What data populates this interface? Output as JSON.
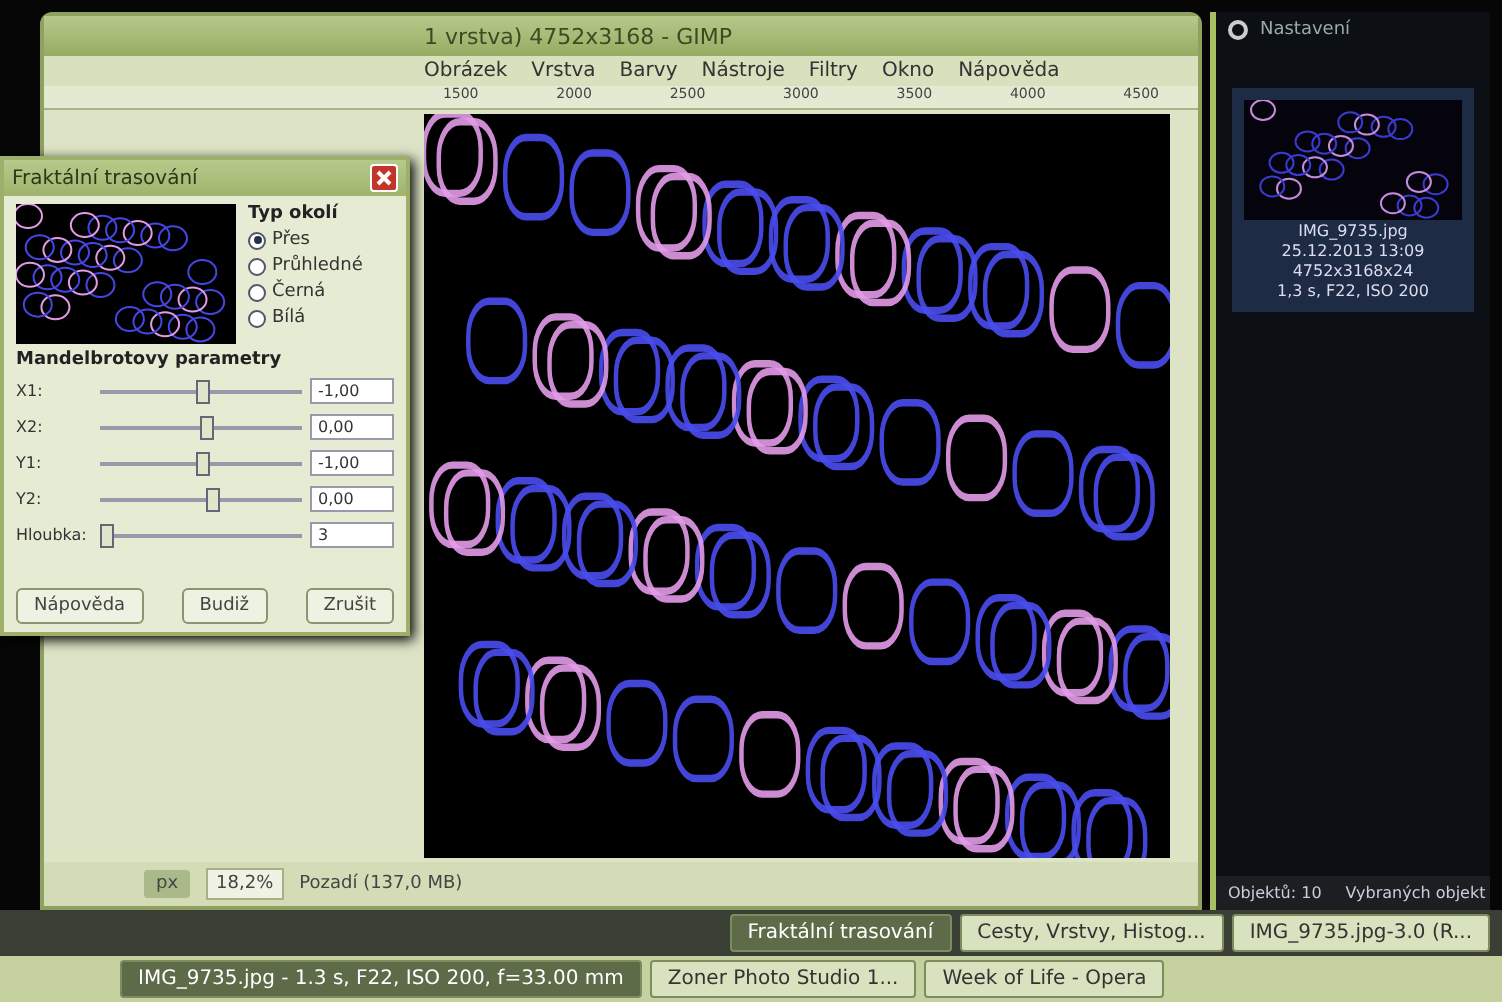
{
  "gimp_window": {
    "title": "1 vrstva) 4752x3168 - GIMP",
    "menu": [
      "Obrázek",
      "Vrstva",
      "Barvy",
      "Nástroje",
      "Filtry",
      "Okno",
      "Nápověda"
    ],
    "ruler_ticks": [
      "1500",
      "2000",
      "2500",
      "3000",
      "3500",
      "4000",
      "4500"
    ],
    "status_bar": {
      "unit": "px",
      "zoom": "18,2%",
      "layer": "Pozadí (137,0 MB)"
    }
  },
  "dialog": {
    "title": "Fraktální trasování",
    "surround": {
      "label": "Typ okolí",
      "options": [
        {
          "label": "Přes",
          "selected": true
        },
        {
          "label": "Průhledné",
          "selected": false
        },
        {
          "label": "Černá",
          "selected": false
        },
        {
          "label": "Bílá",
          "selected": false
        }
      ]
    },
    "section": "Mandelbrotovy parametry",
    "params": [
      {
        "label": "X1:",
        "value": "-1,00",
        "level": 0.5
      },
      {
        "label": "X2:",
        "value": "0,00",
        "level": 0.52
      },
      {
        "label": "Y1:",
        "value": "-1,00",
        "level": 0.5
      },
      {
        "label": "Y2:",
        "value": "0,00",
        "level": 0.55
      },
      {
        "label": "Hloubka:",
        "value": "3",
        "level": 0.03
      }
    ],
    "buttons": [
      "Nápověda",
      "Budiž",
      "Zrušit"
    ]
  },
  "photo_panel": {
    "toolbar_label": "Nastavení",
    "file": "IMG_9735.jpg",
    "date": "25.12.2013 13:09",
    "size": "4752x3168x24",
    "exposure": "1,3 s, F22, ISO 200"
  },
  "panel_status": [
    "Objektů: 10",
    "Vybraných objekt"
  ],
  "taskbar": {
    "upper": [
      {
        "label": "Fraktální trasování",
        "selected": true
      },
      {
        "label": "Cesty, Vrstvy, Histog...",
        "selected": false
      },
      {
        "label": "IMG_9735.jpg-3.0 (R...",
        "selected": false
      }
    ],
    "lower": [
      {
        "label": "IMG_9735.jpg - 1.3 s, F22, ISO 200, f=33.00 mm",
        "selected": true
      },
      {
        "label": "Zoner Photo Studio 1...",
        "selected": false
      },
      {
        "label": "Week of Life - Opera",
        "selected": false
      }
    ]
  }
}
